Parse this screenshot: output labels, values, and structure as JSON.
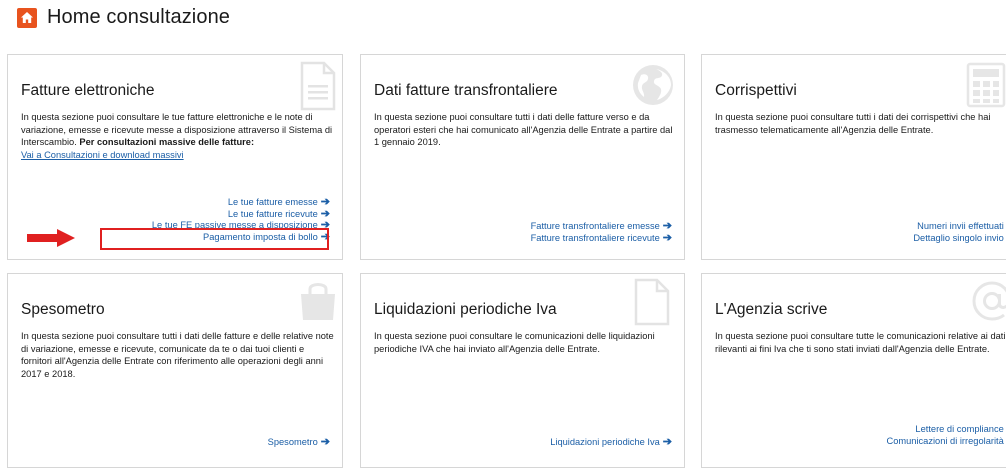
{
  "header": {
    "title": "Home consultazione",
    "icon": "home-icon"
  },
  "cards": [
    {
      "title": "Fatture elettroniche",
      "desc": "In questa sezione puoi consultare le tue fatture elettroniche e le note di variazione, emesse e ricevute messe a disposizione attraverso il Sistema di Interscambio.",
      "desc_bold": "Per consultazioni massive delle fatture:",
      "desc_link": "Vai a Consultazioni e download massivi",
      "icon": "document-icon",
      "links": [
        "Le tue fatture emesse",
        "Le tue fatture ricevute",
        "Le tue FE passive messe a disposizione",
        "Pagamento imposta di bollo"
      ]
    },
    {
      "title": "Dati fatture transfrontaliere",
      "desc": "In questa sezione puoi consultare tutti i dati delle fatture verso e da operatori esteri che hai comunicato all'Agenzia delle Entrate a partire dal 1 gennaio 2019.",
      "icon": "globe-icon",
      "links": [
        "Fatture transfrontaliere emesse",
        "Fatture transfrontaliere ricevute"
      ]
    },
    {
      "title": "Corrispettivi",
      "desc": "In questa sezione puoi consultare tutti i dati dei corrispettivi che hai trasmesso telematicamente all'Agenzia delle Entrate.",
      "icon": "calculator-icon",
      "links": [
        "Numeri invii effettuati",
        "Dettaglio singolo invio"
      ]
    },
    {
      "title": "Spesometro",
      "desc": "In questa sezione puoi consultare tutti i dati delle fatture e delle relative note di variazione, emesse e ricevute, comunicate da te o dai tuoi clienti e fornitori all'Agenzia delle Entrate con riferimento alle operazioni degli anni 2017 e 2018.",
      "icon": "shopping-bag-icon",
      "links": [
        "Spesometro"
      ]
    },
    {
      "title": "Liquidazioni periodiche Iva",
      "desc": "In questa sezione puoi consultare le comunicazioni delle liquidazioni periodiche IVA che hai inviato all'Agenzia delle Entrate.",
      "icon": "blank-document-icon",
      "links": [
        "Liquidazioni periodiche Iva"
      ]
    },
    {
      "title": "L'Agenzia scrive",
      "desc": "In questa sezione puoi consultare tutte le comunicazioni relative ai dati rilevanti ai fini Iva che ti sono stati inviati dall'Agenzia delle Entrate.",
      "icon": "at-sign-icon",
      "links": [
        "Lettere di compliance",
        "Comunicazioni di irregolarità"
      ]
    }
  ],
  "colors": {
    "accent": "#e8531e",
    "link": "#1b5ea6",
    "highlight": "#e02020",
    "icon_gray": "#e6e6e6"
  }
}
